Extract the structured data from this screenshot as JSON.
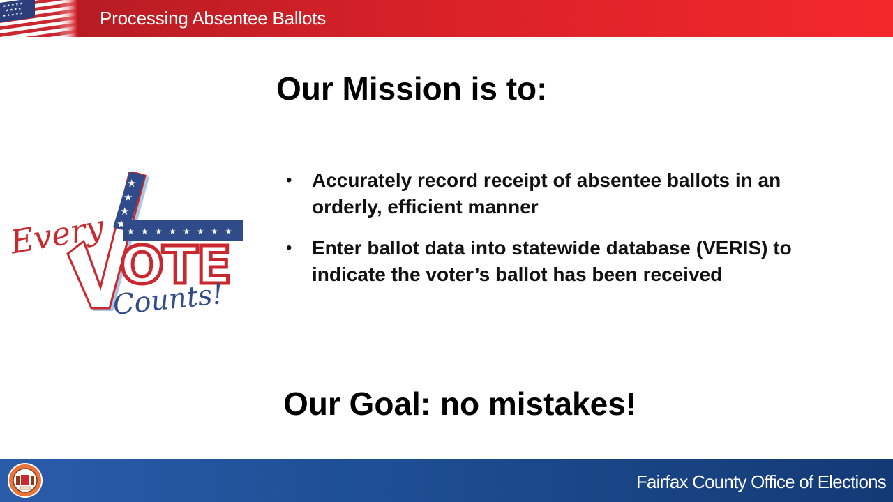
{
  "header": {
    "title": "Processing Absentee Ballots",
    "flag_icon": "us-flag-icon",
    "color": "#d62128"
  },
  "main": {
    "heading": "Our Mission is to:",
    "bullets": [
      {
        "marker": "•",
        "text": "Accurately record receipt of absentee ballots in an orderly, efficient manner"
      },
      {
        "marker": "•",
        "text": "Enter ballot data into statewide database (VERIS) to indicate the voter’s ballot has been received"
      }
    ],
    "goal": "Our Goal: no mistakes!"
  },
  "logo": {
    "word_every": "Every",
    "word_vote": "VOTE",
    "word_counts": "Counts!",
    "colors": {
      "red": "#c8282e",
      "blue": "#2f4b8a",
      "light_blue": "#a9c6e3"
    }
  },
  "footer": {
    "text": "Fairfax County Office of Elections",
    "seal_icon": "county-seal-icon",
    "color": "#1e4f95"
  }
}
